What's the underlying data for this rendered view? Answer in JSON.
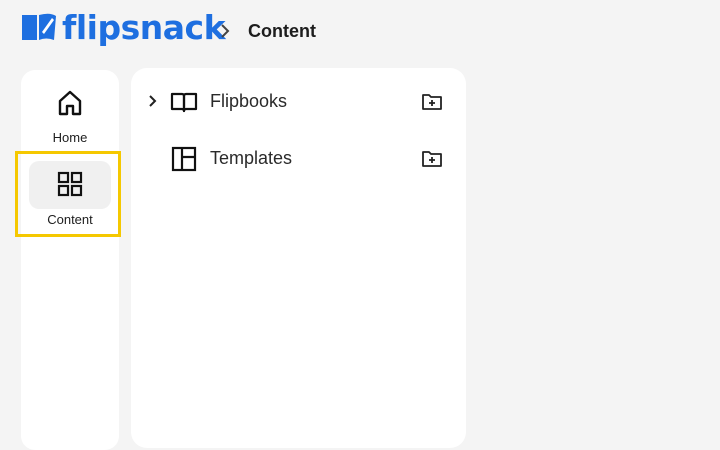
{
  "header": {
    "logo_text": "flipsnack",
    "brand_color": "#1e6fe0",
    "breadcrumb_current": "Content"
  },
  "sidebar": {
    "items": [
      {
        "label": "Home",
        "icon": "home-icon",
        "active": false
      },
      {
        "label": "Content",
        "icon": "grid-icon",
        "active": true
      }
    ],
    "highlight_color": "#f5c800"
  },
  "content_panel": {
    "items": [
      {
        "label": "Flipbooks",
        "icon": "book-open-icon",
        "expandable": true,
        "action_icon": "folder-plus-icon"
      },
      {
        "label": "Templates",
        "icon": "template-layout-icon",
        "expandable": false,
        "action_icon": "folder-plus-icon"
      }
    ]
  }
}
